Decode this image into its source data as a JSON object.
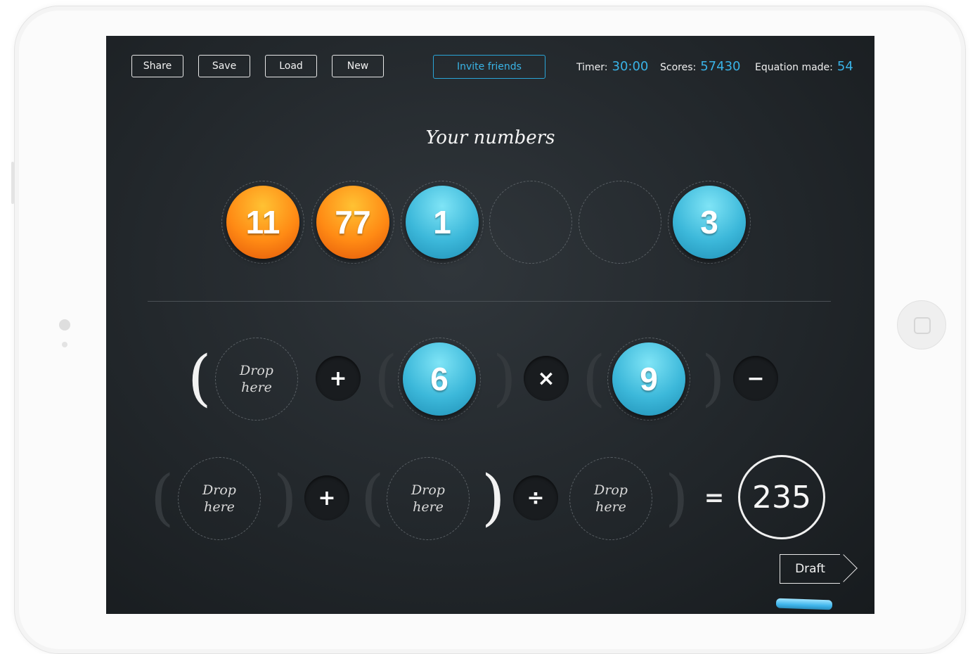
{
  "toolbar": {
    "share_label": "Share",
    "save_label": "Save",
    "load_label": "Load",
    "new_label": "New",
    "invite_label": "Invite friends"
  },
  "stats": {
    "timer_label": "Timer:",
    "timer_value": "30:00",
    "scores_label": "Scores:",
    "scores_value": "57430",
    "equations_label": "Equation made:",
    "equations_value": "54"
  },
  "numbers": {
    "heading": "Your numbers",
    "items": [
      {
        "value": "11",
        "color": "orange"
      },
      {
        "value": "77",
        "color": "orange"
      },
      {
        "value": "1",
        "color": "blue"
      },
      {
        "value": "",
        "color": "empty"
      },
      {
        "value": "",
        "color": "empty"
      },
      {
        "value": "3",
        "color": "blue"
      }
    ]
  },
  "equation": {
    "row1": {
      "drop_line1": "Drop",
      "drop_line2": "here",
      "op1": "+",
      "ball1": "6",
      "op2": "×",
      "ball2": "9",
      "op3": "−"
    },
    "row2": {
      "drop_line1": "Drop",
      "drop_line2": "here",
      "op1": "+",
      "op2": "÷",
      "equals": "=",
      "result": "235"
    }
  },
  "draft_label": "Draft",
  "colors": {
    "accent_blue": "#39b2e6",
    "orange": "#ff8a14",
    "board": "#22272b"
  }
}
